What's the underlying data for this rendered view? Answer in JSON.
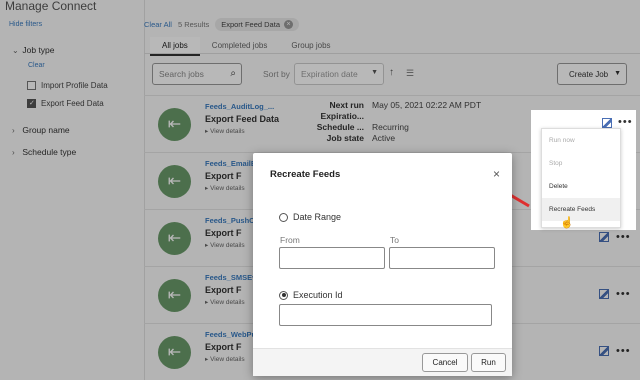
{
  "page": {
    "title": "Manage Connect",
    "hide_filters": "Hide filters"
  },
  "filters": {
    "job_type": "Job type",
    "clear": "Clear",
    "options": [
      {
        "label": "Import Profile Data",
        "checked": false
      },
      {
        "label": "Export Feed Data",
        "checked": true
      }
    ],
    "group_name": "Group name",
    "schedule_type": "Schedule type"
  },
  "toolbar": {
    "clear_all": "Clear All",
    "results": "5 Results",
    "chip": "Export Feed Data",
    "tabs": [
      "All jobs",
      "Completed jobs",
      "Group jobs"
    ],
    "search_placeholder": "Search jobs",
    "sort_by": "Sort by",
    "sort_value": "Expiration date",
    "create_job": "Create Job"
  },
  "rows": [
    {
      "name": "Feeds_AuditLog_...",
      "type": "Export Feed Data",
      "details": "View details",
      "meta": [
        {
          "k": "Next run",
          "v": "May 05, 2021 02:22 AM PDT"
        },
        {
          "k": "Expiratio...",
          "v": ""
        },
        {
          "k": "Schedule ...",
          "v": "Recurring"
        },
        {
          "k": "Job state",
          "v": "Active"
        }
      ]
    },
    {
      "name": "Feeds_EmailE",
      "type": "Export F",
      "details": "View details"
    },
    {
      "name": "Feeds_PushCh",
      "type": "Export F",
      "details": "View details"
    },
    {
      "name": "Feeds_SMSEv",
      "type": "Export F",
      "details": "View details"
    },
    {
      "name": "Feeds_WebPu",
      "type": "Export F",
      "details": "View details"
    }
  ],
  "menu": {
    "items": [
      {
        "label": "Run now",
        "disabled": true
      },
      {
        "label": "Stop",
        "disabled": true
      },
      {
        "label": "Delete",
        "disabled": false
      },
      {
        "label": "Recreate Feeds",
        "disabled": false
      }
    ]
  },
  "modal": {
    "title": "Recreate Feeds",
    "date_range": "Date Range",
    "from": "From",
    "to": "To",
    "execution_id": "Execution Id",
    "cancel": "Cancel",
    "run": "Run"
  },
  "colors": {
    "accent": "#3a7bbf",
    "avatar": "#6a9a6a",
    "arrow": "#e03030"
  }
}
